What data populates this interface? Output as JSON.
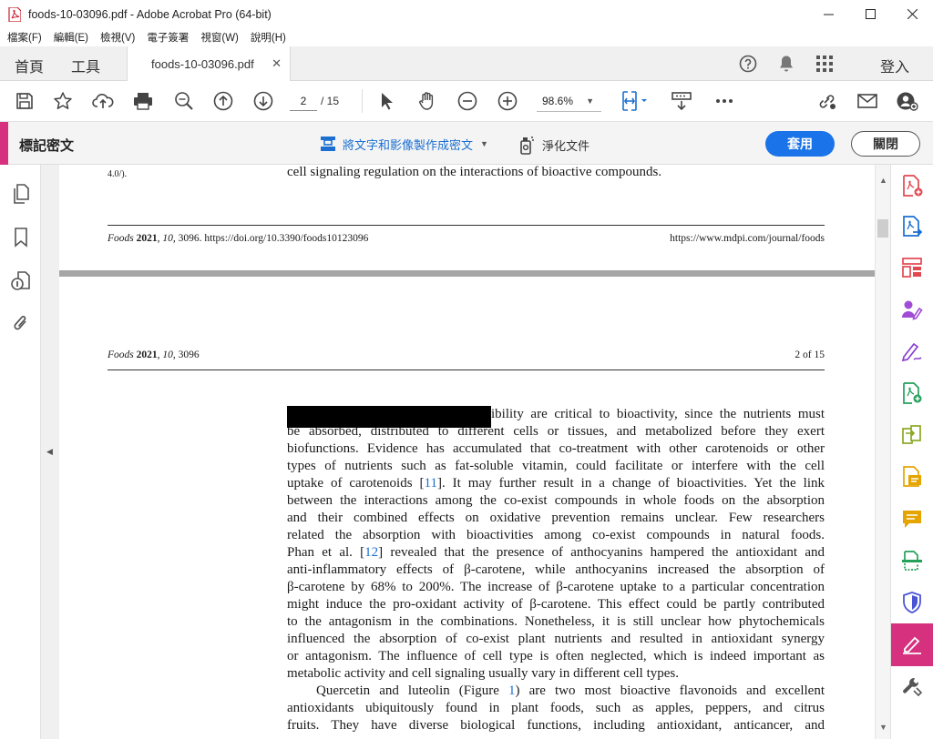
{
  "window": {
    "title": "foods-10-03096.pdf - Adobe Acrobat Pro (64-bit)",
    "minimize": "—",
    "maximize": "☐",
    "close": "✕"
  },
  "menu": [
    "檔案(F)",
    "編輯(E)",
    "檢視(V)",
    "電子簽署",
    "視窗(W)",
    "說明(H)"
  ],
  "tabs": {
    "home": "首頁",
    "tools": "工具",
    "document": "foods-10-03096.pdf",
    "close": "✕",
    "signin": "登入"
  },
  "toolbar": {
    "page_current": "2",
    "page_total": "/ 15",
    "zoom": "98.6%"
  },
  "redact": {
    "title": "標記密文",
    "mark_text_images": "將文字和影像製作成密文",
    "sanitize": "淨化文件",
    "apply": "套用",
    "close": "關閉"
  },
  "document": {
    "prev_page_fragment_left": "4.0/).",
    "prev_page_last_line": "cell signaling regulation on the interactions of bioactive compounds.",
    "prev_footer_journal": "Foods",
    "prev_footer_year": "2021",
    "prev_footer_volume": "10",
    "prev_footer_rest": ", 3096. https://doi.org/10.3390/foods10123096",
    "prev_footer_url": "https://www.mdpi.com/journal/foods",
    "header_journal": "Foods",
    "header_year": "2021",
    "header_volume": "10",
    "header_rest": ", 3096",
    "header_page": "2 of 15",
    "para1_lines": [
      "ibility are critical to bioactivity, since the nutrients must",
      "be absorbed, distributed to different cells or tissues, and metabolized before they exert",
      "biofunctions. Evidence has accumulated that co-treatment with other carotenoids or other",
      "types of nutrients such as fat-soluble vitamin, could facilitate or interfere with the cell",
      "uptake of carotenoids [11]. It may further result in a change of bioactivities. Yet the link",
      "between the interactions among the co-exist compounds in whole foods on the absorption",
      "and their combined effects on oxidative prevention remains unclear. Few researchers",
      "related the absorption with bioactivities among co-exist compounds in natural foods.",
      "Phan et al. [12] revealed that the presence of anthocyanins hampered the antioxidant and",
      "anti-inflammatory effects of β-carotene, while anthocyanins increased the absorption of",
      "β-carotene by 68% to 200%. The increase of β-carotene uptake to a particular concentration",
      "might induce the pro-oxidant activity of β-carotene. This effect could be partly contributed",
      "to the antagonism in the combinations. Nonetheless, it is still unclear how phytochemicals",
      "influenced the absorption of co-exist plant nutrients and resulted in antioxidant synergy",
      "or antagonism. The influence of cell type is often neglected, which is indeed important as",
      "metabolic activity and cell signaling usually vary in different cell types."
    ],
    "para2_lines": [
      "Quercetin and luteolin (Figure 1) are two most bioactive flavonoids and excellent",
      "antioxidants ubiquitously found in plant foods, such as apples, peppers, and citrus",
      "fruits. They have diverse biological functions, including antioxidant, anticancer, and"
    ]
  },
  "colors": {
    "accent_pink": "#d6317f",
    "apply_blue": "#1a73e8",
    "link_blue": "#1a6fd1"
  }
}
